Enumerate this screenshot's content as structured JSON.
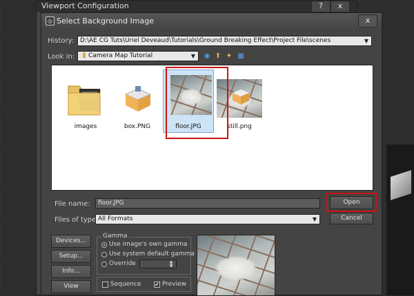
{
  "outer_window": {
    "title": "Viewport Configuration",
    "help_btn": "?",
    "close_btn": "x"
  },
  "dialog": {
    "title": "Select Background Image",
    "close_btn": "x",
    "history": {
      "label": "History:",
      "value": "D:\\AE CG Tuts\\Uriel Deveaud\\Tutorials\\Ground Breaking Effect\\Project File\\scenes"
    },
    "look_in": {
      "label": "Look in:",
      "value": "Camera Map Tutorial"
    },
    "files": [
      {
        "name": "images",
        "type": "folder"
      },
      {
        "name": "box.PNG",
        "type": "image"
      },
      {
        "name": "floor.JPG",
        "type": "image",
        "selected": true
      },
      {
        "name": "still.png",
        "type": "image"
      }
    ],
    "file_name": {
      "label": "File name:",
      "value": "floor.JPG"
    },
    "files_of_type": {
      "label": "Files of type:",
      "value": "All Formats"
    },
    "buttons": {
      "open": "Open",
      "cancel": "Cancel",
      "devices": "Devices...",
      "setup": "Setup...",
      "info": "Info...",
      "view": "View"
    },
    "gamma": {
      "title": "Gamma",
      "options": [
        "Use image's own gamma",
        "Use system default gamma",
        "Override"
      ],
      "selected": 0
    },
    "sequence_label": "Sequence",
    "preview_label": "Preview",
    "preview_checked": true,
    "sequence_checked": false
  },
  "colors": {
    "highlight_red": "#cc1111",
    "selection_blue": "#cde4f7"
  }
}
